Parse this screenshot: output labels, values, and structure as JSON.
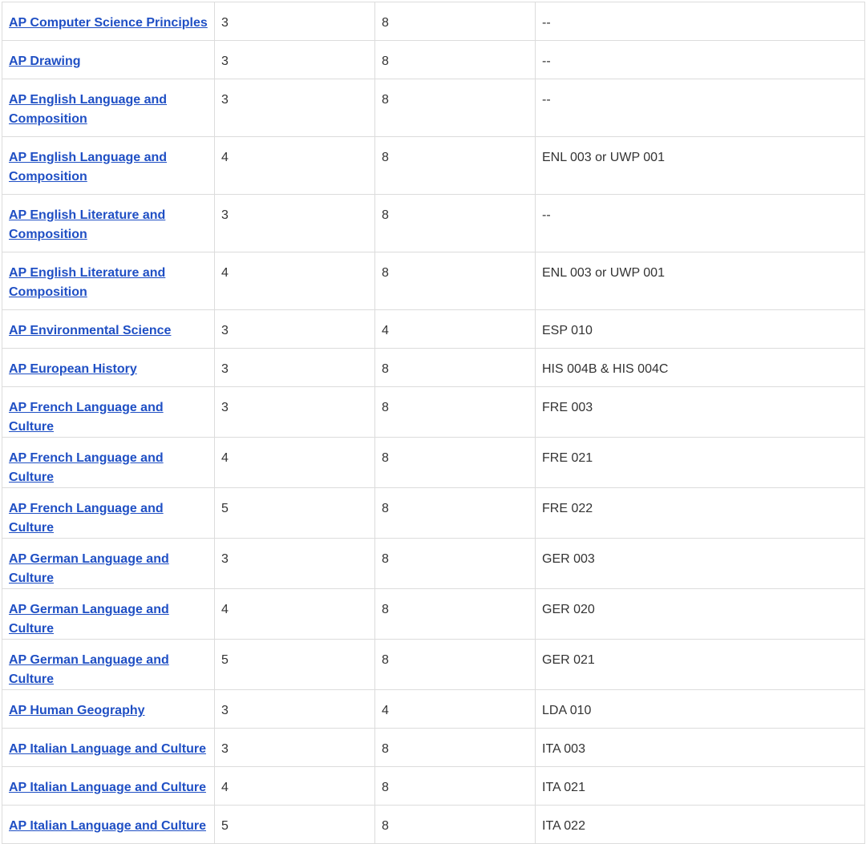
{
  "rows": [
    {
      "course": "AP Computer Science Principles",
      "score": "3",
      "units": "8",
      "equivalent": "--"
    },
    {
      "course": "AP Drawing",
      "score": "3",
      "units": "8",
      "equivalent": "--"
    },
    {
      "course": "AP English Language and Composition",
      "score": "3",
      "units": "8",
      "equivalent": "--"
    },
    {
      "course": "AP English Language and Composition",
      "score": "4",
      "units": "8",
      "equivalent": "ENL 003 or UWP 001"
    },
    {
      "course": "AP English Literature and Composition",
      "score": "3",
      "units": "8",
      "equivalent": "--"
    },
    {
      "course": "AP English Literature and Composition",
      "score": "4",
      "units": "8",
      "equivalent": "ENL 003 or UWP 001"
    },
    {
      "course": "AP Environmental Science",
      "score": "3",
      "units": "4",
      "equivalent": "ESP 010"
    },
    {
      "course": "AP European History",
      "score": "3",
      "units": "8",
      "equivalent": "HIS 004B & HIS 004C"
    },
    {
      "course": "AP French Language and Culture",
      "score": "3",
      "units": "8",
      "equivalent": "FRE 003"
    },
    {
      "course": "AP French Language and Culture",
      "score": "4",
      "units": "8",
      "equivalent": "FRE 021"
    },
    {
      "course": "AP French Language and Culture",
      "score": "5",
      "units": "8",
      "equivalent": "FRE 022"
    },
    {
      "course": "AP German Language and Culture",
      "score": "3",
      "units": "8",
      "equivalent": "GER 003"
    },
    {
      "course": "AP German Language and Culture",
      "score": "4",
      "units": "8",
      "equivalent": "GER 020"
    },
    {
      "course": "AP German Language and Culture",
      "score": "5",
      "units": "8",
      "equivalent": "GER 021"
    },
    {
      "course": "AP Human Geography",
      "score": "3",
      "units": "4",
      "equivalent": "LDA 010"
    },
    {
      "course": "AP Italian Language and Culture",
      "score": "3",
      "units": "8",
      "equivalent": "ITA 003"
    },
    {
      "course": "AP Italian Language and Culture",
      "score": "4",
      "units": "8",
      "equivalent": "ITA 021"
    },
    {
      "course": "AP Italian Language and Culture",
      "score": "5",
      "units": "8",
      "equivalent": "ITA 022"
    }
  ]
}
